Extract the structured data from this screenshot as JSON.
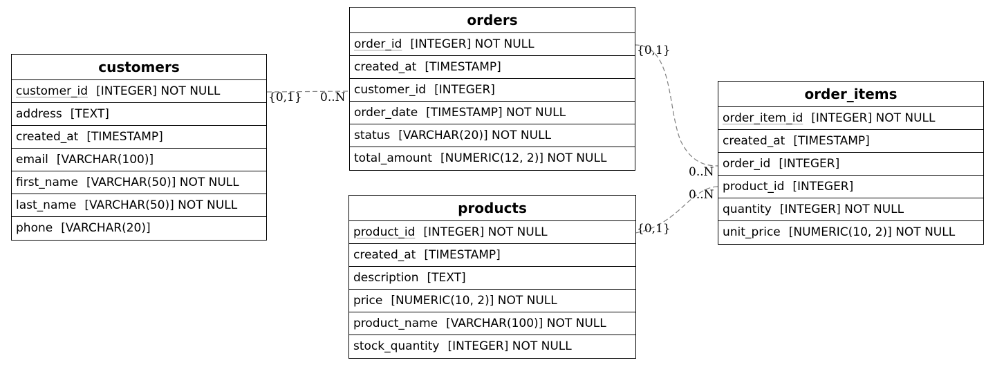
{
  "entities": {
    "customers": {
      "name": "customers",
      "columns": [
        {
          "name": "customer_id",
          "type": "[INTEGER] NOT NULL",
          "pk": true
        },
        {
          "name": "address",
          "type": "[TEXT]"
        },
        {
          "name": "created_at",
          "type": "[TIMESTAMP]"
        },
        {
          "name": "email",
          "type": "[VARCHAR(100)]"
        },
        {
          "name": "first_name",
          "type": "[VARCHAR(50)] NOT NULL"
        },
        {
          "name": "last_name",
          "type": "[VARCHAR(50)] NOT NULL"
        },
        {
          "name": "phone",
          "type": "[VARCHAR(20)]"
        }
      ]
    },
    "orders": {
      "name": "orders",
      "columns": [
        {
          "name": "order_id",
          "type": "[INTEGER] NOT NULL",
          "pk": true
        },
        {
          "name": "created_at",
          "type": "[TIMESTAMP]"
        },
        {
          "name": "customer_id",
          "type": "[INTEGER]"
        },
        {
          "name": "order_date",
          "type": "[TIMESTAMP] NOT NULL"
        },
        {
          "name": "status",
          "type": "[VARCHAR(20)] NOT NULL"
        },
        {
          "name": "total_amount",
          "type": "[NUMERIC(12, 2)] NOT NULL"
        }
      ]
    },
    "products": {
      "name": "products",
      "columns": [
        {
          "name": "product_id",
          "type": "[INTEGER] NOT NULL",
          "pk": true
        },
        {
          "name": "created_at",
          "type": "[TIMESTAMP]"
        },
        {
          "name": "description",
          "type": "[TEXT]"
        },
        {
          "name": "price",
          "type": "[NUMERIC(10, 2)] NOT NULL"
        },
        {
          "name": "product_name",
          "type": "[VARCHAR(100)] NOT NULL"
        },
        {
          "name": "stock_quantity",
          "type": "[INTEGER] NOT NULL"
        }
      ]
    },
    "order_items": {
      "name": "order_items",
      "columns": [
        {
          "name": "order_item_id",
          "type": "[INTEGER] NOT NULL",
          "pk": true
        },
        {
          "name": "created_at",
          "type": "[TIMESTAMP]"
        },
        {
          "name": "order_id",
          "type": "[INTEGER]"
        },
        {
          "name": "product_id",
          "type": "[INTEGER]"
        },
        {
          "name": "quantity",
          "type": "[INTEGER] NOT NULL"
        },
        {
          "name": "unit_price",
          "type": "[NUMERIC(10, 2)] NOT NULL"
        }
      ]
    }
  },
  "relationships": {
    "customers_orders": {
      "from": "customers.customer_id",
      "to": "orders.customer_id",
      "one_label": "{0,1}",
      "many_label": "0..N"
    },
    "orders_order_items": {
      "from": "orders.order_id",
      "to": "order_items.order_id",
      "one_label": "{0,1}",
      "many_label": "0..N"
    },
    "products_order_items": {
      "from": "products.product_id",
      "to": "order_items.product_id",
      "one_label": "{0,1}",
      "many_label": "0..N"
    }
  },
  "colors": {
    "border": "#000000",
    "line": "#7f7f7f",
    "pk_underline": "#9a9a9a",
    "background": "#ffffff"
  }
}
